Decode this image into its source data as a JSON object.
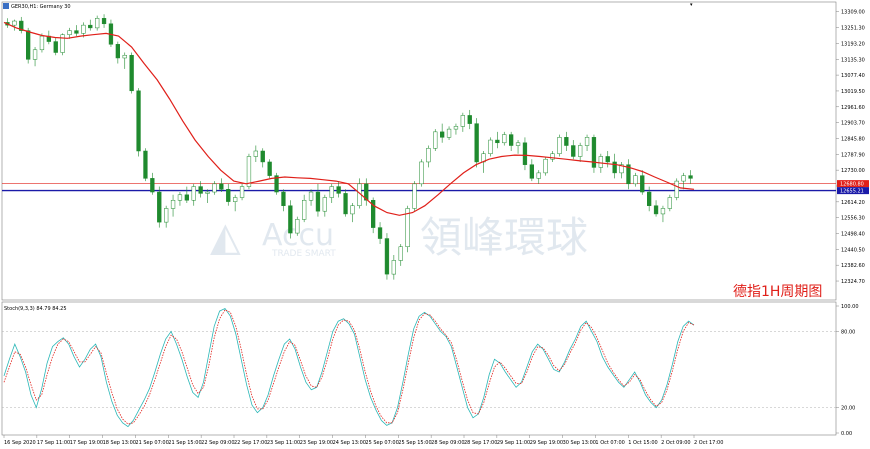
{
  "header": {
    "symbol_title": "GER30,H1:  Germany 30"
  },
  "watermark": {
    "brand_en": "Accu",
    "brand_cn": "領峰環球",
    "tagline": "TRADE SMART"
  },
  "annotation": "德指1H周期图",
  "price_labels": {
    "bid_tag": "12680.80",
    "support_tag": "12655.21"
  },
  "stoch_header": "Stoch(9,3,3) 84.79 84.25",
  "colors": {
    "bull": "#1f8a2e",
    "bear": "#1f8a2e",
    "ma": "#e0201a",
    "support_line": "#1a1aa8",
    "bid_line": "#e0201a",
    "stoch_main": "#2ab7b7",
    "stoch_signal": "#e0201a",
    "annotation": "#e0201a"
  },
  "chart_data": [
    {
      "type": "candlestick",
      "title": "GER30,H1:  Germany 30",
      "y_ticks": [
        "13309.00",
        "13251.30",
        "13193.20",
        "13135.30",
        "13077.40",
        "13019.50",
        "12961.60",
        "12903.70",
        "12845.80",
        "12787.90",
        "12730.00",
        "12672.10",
        "12614.20",
        "12556.30",
        "12498.40",
        "12440.50",
        "12382.60",
        "12324.70"
      ],
      "ylim": [
        12270.0,
        13330.0
      ],
      "x_ticks": [
        "16 Sep 2020",
        "17 Sep 11:00",
        "17 Sep 19:00",
        "18 Sep 13:00",
        "21 Sep 07:00",
        "21 Sep 15:00",
        "22 Sep 09:00",
        "22 Sep 17:00",
        "23 Sep 11:00",
        "23 Sep 19:00",
        "24 Sep 13:00",
        "25 Sep 07:00",
        "25 Sep 15:00",
        "28 Sep 09:00",
        "28 Sep 17:00",
        "29 Sep 11:00",
        "29 Sep 19:00",
        "30 Sep 13:00",
        "1 Oct 07:00",
        "1 Oct 15:00",
        "2 Oct 09:00",
        "2 Oct 17:00"
      ],
      "horizontal_lines": {
        "bid": 12680.8,
        "support": 12655.21
      },
      "ma_values": [
        13270,
        13250,
        13235,
        13222,
        13215,
        13212,
        13220,
        13225,
        13230,
        13220,
        13180,
        13120,
        13060,
        12990,
        12910,
        12840,
        12780,
        12730,
        12690,
        12680,
        12690,
        12700,
        12705,
        12702,
        12700,
        12695,
        12690,
        12680,
        12640,
        12600,
        12575,
        12565,
        12575,
        12600,
        12640,
        12680,
        12720,
        12750,
        12770,
        12780,
        12785,
        12784,
        12780,
        12775,
        12770,
        12765,
        12760,
        12755,
        12750,
        12740,
        12725,
        12705,
        12685,
        12665,
        12660
      ],
      "ma_x": [
        0,
        0.018,
        0.037,
        0.055,
        0.074,
        0.092,
        0.111,
        0.129,
        0.148,
        0.166,
        0.185,
        0.203,
        0.222,
        0.24,
        0.259,
        0.277,
        0.296,
        0.314,
        0.333,
        0.351,
        0.37,
        0.388,
        0.407,
        0.425,
        0.444,
        0.462,
        0.481,
        0.499,
        0.518,
        0.536,
        0.555,
        0.573,
        0.592,
        0.61,
        0.629,
        0.647,
        0.666,
        0.684,
        0.703,
        0.721,
        0.74,
        0.758,
        0.777,
        0.795,
        0.814,
        0.832,
        0.851,
        0.869,
        0.888,
        0.906,
        0.925,
        0.943,
        0.962,
        0.98,
        1.0
      ],
      "candles": [
        [
          13270,
          13285,
          13250,
          13260
        ],
        [
          13260,
          13280,
          13240,
          13275
        ],
        [
          13275,
          13290,
          13230,
          13240
        ],
        [
          13240,
          13250,
          13120,
          13135
        ],
        [
          13135,
          13180,
          13110,
          13170
        ],
        [
          13170,
          13230,
          13160,
          13220
        ],
        [
          13220,
          13240,
          13190,
          13200
        ],
        [
          13200,
          13215,
          13150,
          13160
        ],
        [
          13160,
          13230,
          13150,
          13225
        ],
        [
          13225,
          13250,
          13210,
          13240
        ],
        [
          13240,
          13260,
          13220,
          13230
        ],
        [
          13230,
          13270,
          13215,
          13260
        ],
        [
          13260,
          13280,
          13240,
          13250
        ],
        [
          13250,
          13295,
          13240,
          13285
        ],
        [
          13285,
          13300,
          13250,
          13265
        ],
        [
          13265,
          13280,
          13180,
          13190
        ],
        [
          13190,
          13200,
          13120,
          13140
        ],
        [
          13140,
          13160,
          13100,
          13150
        ],
        [
          13150,
          13160,
          13010,
          13020
        ],
        [
          13020,
          13030,
          12780,
          12800
        ],
        [
          12800,
          12810,
          12690,
          12700
        ],
        [
          12700,
          12720,
          12640,
          12650
        ],
        [
          12650,
          12670,
          12520,
          12540
        ],
        [
          12540,
          12600,
          12520,
          12590
        ],
        [
          12590,
          12640,
          12560,
          12620
        ],
        [
          12620,
          12650,
          12600,
          12640
        ],
        [
          12640,
          12670,
          12610,
          12620
        ],
        [
          12620,
          12680,
          12600,
          12670
        ],
        [
          12670,
          12690,
          12630,
          12645
        ],
        [
          12645,
          12660,
          12610,
          12650
        ],
        [
          12650,
          12690,
          12640,
          12680
        ],
        [
          12680,
          12700,
          12650,
          12660
        ],
        [
          12660,
          12680,
          12600,
          12615
        ],
        [
          12615,
          12640,
          12580,
          12630
        ],
        [
          12630,
          12680,
          12620,
          12670
        ],
        [
          12670,
          12790,
          12660,
          12780
        ],
        [
          12780,
          12820,
          12760,
          12800
        ],
        [
          12800,
          12810,
          12740,
          12760
        ],
        [
          12760,
          12770,
          12700,
          12710
        ],
        [
          12710,
          12720,
          12640,
          12650
        ],
        [
          12650,
          12660,
          12580,
          12600
        ],
        [
          12600,
          12620,
          12480,
          12500
        ],
        [
          12500,
          12560,
          12490,
          12550
        ],
        [
          12550,
          12640,
          12540,
          12620
        ],
        [
          12620,
          12660,
          12600,
          12650
        ],
        [
          12650,
          12680,
          12560,
          12580
        ],
        [
          12580,
          12640,
          12560,
          12630
        ],
        [
          12630,
          12680,
          12610,
          12670
        ],
        [
          12670,
          12690,
          12630,
          12645
        ],
        [
          12645,
          12660,
          12560,
          12570
        ],
        [
          12570,
          12610,
          12540,
          12600
        ],
        [
          12600,
          12700,
          12590,
          12680
        ],
        [
          12680,
          12700,
          12600,
          12620
        ],
        [
          12620,
          12630,
          12500,
          12520
        ],
        [
          12520,
          12540,
          12460,
          12480
        ],
        [
          12480,
          12500,
          12330,
          12350
        ],
        [
          12350,
          12420,
          12330,
          12400
        ],
        [
          12400,
          12460,
          12380,
          12450
        ],
        [
          12450,
          12600,
          12430,
          12590
        ],
        [
          12590,
          12690,
          12580,
          12680
        ],
        [
          12680,
          12770,
          12670,
          12760
        ],
        [
          12760,
          12820,
          12740,
          12810
        ],
        [
          12810,
          12880,
          12800,
          12870
        ],
        [
          12870,
          12900,
          12830,
          12850
        ],
        [
          12850,
          12890,
          12840,
          12880
        ],
        [
          12880,
          12900,
          12860,
          12890
        ],
        [
          12890,
          12940,
          12870,
          12930
        ],
        [
          12930,
          12950,
          12880,
          12900
        ],
        [
          12900,
          12920,
          12740,
          12760
        ],
        [
          12760,
          12800,
          12720,
          12790
        ],
        [
          12790,
          12850,
          12780,
          12840
        ],
        [
          12840,
          12870,
          12810,
          12830
        ],
        [
          12830,
          12870,
          12820,
          12860
        ],
        [
          12860,
          12870,
          12800,
          12820
        ],
        [
          12820,
          12840,
          12790,
          12830
        ],
        [
          12830,
          12850,
          12730,
          12750
        ],
        [
          12750,
          12770,
          12690,
          12700
        ],
        [
          12700,
          12730,
          12680,
          12720
        ],
        [
          12720,
          12780,
          12710,
          12770
        ],
        [
          12770,
          12800,
          12760,
          12790
        ],
        [
          12790,
          12860,
          12780,
          12850
        ],
        [
          12850,
          12870,
          12800,
          12820
        ],
        [
          12820,
          12840,
          12770,
          12780
        ],
        [
          12780,
          12830,
          12760,
          12820
        ],
        [
          12820,
          12860,
          12800,
          12850
        ],
        [
          12850,
          12860,
          12720,
          12740
        ],
        [
          12740,
          12790,
          12720,
          12780
        ],
        [
          12780,
          12800,
          12740,
          12760
        ],
        [
          12760,
          12790,
          12700,
          12720
        ],
        [
          12720,
          12760,
          12700,
          12750
        ],
        [
          12750,
          12770,
          12660,
          12680
        ],
        [
          12680,
          12720,
          12670,
          12710
        ],
        [
          12710,
          12730,
          12640,
          12650
        ],
        [
          12650,
          12670,
          12580,
          12600
        ],
        [
          12600,
          12620,
          12560,
          12570
        ],
        [
          12570,
          12600,
          12540,
          12590
        ],
        [
          12590,
          12640,
          12580,
          12630
        ],
        [
          12630,
          12700,
          12620,
          12690
        ],
        [
          12690,
          12720,
          12660,
          12710
        ],
        [
          12710,
          12730,
          12680,
          12700
        ]
      ]
    },
    {
      "type": "line",
      "title": "Stoch(9,3,3) 84.79 84.25",
      "y_ticks": [
        "100.00",
        "80.00",
        "20.00",
        "0.00"
      ],
      "ylim": [
        0,
        100
      ],
      "levels": [
        80,
        20
      ],
      "series": [
        {
          "role": "main",
          "values": [
            45,
            58,
            70,
            60,
            48,
            30,
            20,
            35,
            55,
            68,
            72,
            75,
            70,
            60,
            52,
            58,
            66,
            70,
            60,
            40,
            25,
            14,
            8,
            5,
            10,
            18,
            26,
            35,
            48,
            62,
            74,
            80,
            70,
            58,
            44,
            32,
            28,
            40,
            62,
            84,
            96,
            98,
            92,
            78,
            58,
            38,
            22,
            16,
            20,
            30,
            45,
            58,
            70,
            74,
            66,
            52,
            40,
            34,
            36,
            48,
            64,
            80,
            88,
            90,
            86,
            78,
            60,
            42,
            28,
            18,
            10,
            6,
            8,
            20,
            40,
            62,
            82,
            92,
            95,
            92,
            86,
            80,
            76,
            68,
            52,
            36,
            20,
            12,
            15,
            28,
            46,
            58,
            55,
            48,
            42,
            36,
            40,
            52,
            64,
            70,
            66,
            58,
            50,
            48,
            56,
            66,
            74,
            84,
            88,
            80,
            72,
            60,
            52,
            46,
            40,
            36,
            42,
            48,
            40,
            30,
            24,
            20,
            26,
            38,
            54,
            72,
            84,
            88,
            85
          ]
        },
        {
          "role": "signal",
          "values": [
            40,
            52,
            64,
            62,
            52,
            38,
            26,
            30,
            46,
            60,
            70,
            74,
            72,
            64,
            56,
            56,
            62,
            68,
            63,
            47,
            32,
            19,
            11,
            7,
            8,
            14,
            21,
            30,
            42,
            55,
            68,
            77,
            74,
            64,
            51,
            38,
            31,
            36,
            53,
            75,
            90,
            97,
            95,
            84,
            66,
            46,
            29,
            19,
            19,
            26,
            39,
            52,
            64,
            72,
            69,
            57,
            45,
            37,
            36,
            44,
            58,
            74,
            85,
            89,
            88,
            81,
            66,
            48,
            33,
            21,
            13,
            8,
            8,
            16,
            34,
            55,
            75,
            89,
            94,
            93,
            88,
            82,
            77,
            71,
            57,
            41,
            26,
            16,
            15,
            24,
            39,
            52,
            56,
            51,
            45,
            39,
            39,
            48,
            60,
            68,
            67,
            61,
            53,
            49,
            54,
            63,
            71,
            81,
            87,
            83,
            75,
            65,
            55,
            48,
            42,
            37,
            40,
            46,
            42,
            33,
            26,
            21,
            24,
            34,
            49,
            66,
            80,
            87,
            85
          ]
        }
      ]
    }
  ]
}
